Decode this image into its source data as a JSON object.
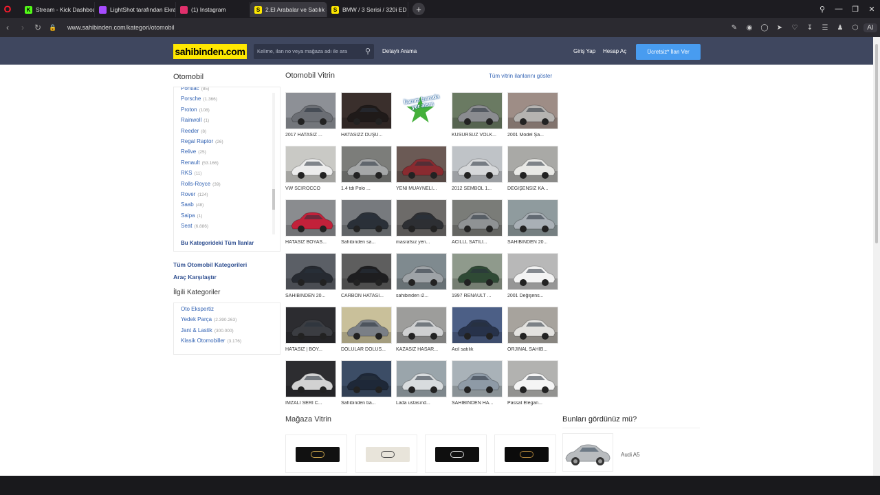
{
  "browser": {
    "tabs": [
      {
        "label": "Stream - Kick Dashboard",
        "icon": "kick-icon",
        "color": "#53fc18",
        "glyph": "K",
        "active": false
      },
      {
        "label": "LightShot tarafından Ekra",
        "icon": "lightshot-icon",
        "color": "#a64bff",
        "glyph": "",
        "active": false
      },
      {
        "label": "(1) Instagram",
        "icon": "instagram-icon",
        "color": "#e1306c",
        "glyph": "",
        "active": false
      },
      {
        "label": "2.El Arabalar ve Satılık Sıfı",
        "icon": "sahibinden-favicon",
        "color": "#ffe800",
        "glyph": "S",
        "active": true
      },
      {
        "label": "BMW / 3 Serisi / 320i ED /",
        "icon": "sahibinden-favicon",
        "color": "#ffe800",
        "glyph": "S",
        "active": false
      }
    ],
    "url_host": "www.sahibinden.com",
    "url_path": "/kategori/otomobil",
    "ai_label": "AI"
  },
  "header": {
    "logo": "sahibinden.com",
    "search_placeholder": "Kelime, ilan no veya mağaza adı ile ara",
    "advanced_search": "Detaylı Arama",
    "login": "Giriş Yap",
    "register": "Hesap Aç",
    "post_ad": "Ücretsiz* İlan Ver"
  },
  "sidebar": {
    "title": "Otomobil",
    "brands": [
      {
        "name": "Pontiac",
        "count": "(85)"
      },
      {
        "name": "Porsche",
        "count": "(1.366)"
      },
      {
        "name": "Proton",
        "count": "(108)"
      },
      {
        "name": "Rainwoll",
        "count": "(1)"
      },
      {
        "name": "Reeder",
        "count": "(8)"
      },
      {
        "name": "Regal Raptor",
        "count": "(26)"
      },
      {
        "name": "Relive",
        "count": "(25)"
      },
      {
        "name": "Renault",
        "count": "(53.166)"
      },
      {
        "name": "RKS",
        "count": "(11)"
      },
      {
        "name": "Rolls-Royce",
        "count": "(39)"
      },
      {
        "name": "Rover",
        "count": "(124)"
      },
      {
        "name": "Saab",
        "count": "(48)"
      },
      {
        "name": "Saipa",
        "count": "(1)"
      },
      {
        "name": "Seat",
        "count": "(6.886)"
      }
    ],
    "all_in_category": "Bu Kategorideki Tüm İlanlar",
    "all_categories": "Tüm Otomobil Kategorileri",
    "compare": "Araç Karşılaştır",
    "related_title": "İlgili Kategoriler",
    "related": [
      {
        "name": "Oto Ekspertiz",
        "count": ""
      },
      {
        "name": "Yedek Parça",
        "count": "(2.390.263)"
      },
      {
        "name": "Jant & Lastik",
        "count": "(300.000)"
      },
      {
        "name": "Klasik Otomobiller",
        "count": "(3.176)"
      }
    ]
  },
  "vitrin": {
    "title": "Otomobil Vitrin",
    "show_all": "Tüm vitrin ilanlarını göster",
    "ad_promo": "İlanım burada yer alsın",
    "items": [
      {
        "caption": "2017 HATASIZ ...",
        "bg": "#8d9096",
        "car": "#6b6e74"
      },
      {
        "caption": "HATASIZZ DÜŞÜ...",
        "bg": "#3a2f2c",
        "car": "#1f1a19"
      },
      {
        "caption": "",
        "bg": "#ffffff",
        "car": "",
        "promo": true
      },
      {
        "caption": "KUSURSUZ VOLK...",
        "bg": "#6a7a62",
        "car": "#8a8c90"
      },
      {
        "caption": "2001 Model Şa...",
        "bg": "#9e8d86",
        "car": "#b5b3b0"
      },
      {
        "caption": "VW SCİROCCO",
        "bg": "#c9c9c5",
        "car": "#ececec"
      },
      {
        "caption": "1.4 tdi Polo ...",
        "bg": "#7c7d7a",
        "car": "#a5a7a8"
      },
      {
        "caption": "YENİ MUAYNELİ...",
        "bg": "#6b5a55",
        "car": "#8a2b30"
      },
      {
        "caption": "2012 SEMBOL 1...",
        "bg": "#bfc3c7",
        "car": "#d6d8da"
      },
      {
        "caption": "DEĞİŞENSİZ KA...",
        "bg": "#a9a9a6",
        "car": "#e9e9e6"
      },
      {
        "caption": "HATASIZ BOYAS...",
        "bg": "#8a8c8f",
        "car": "#c2213a"
      },
      {
        "caption": "Sahibinden sa...",
        "bg": "#777a7e",
        "car": "#2a3038"
      },
      {
        "caption": "masrafsız yen...",
        "bg": "#6d6b69",
        "car": "#2d2f33"
      },
      {
        "caption": "ACİLLL SATILI...",
        "bg": "#7a7c78",
        "car": "#8f9294"
      },
      {
        "caption": "SAHİBİNDEN 20...",
        "bg": "#8f9b9e",
        "car": "#a9b0b6"
      },
      {
        "caption": "SAHİBİNDEN 20...",
        "bg": "#5b5f66",
        "car": "#262a31"
      },
      {
        "caption": "CARBON HATASI...",
        "bg": "#5e5e5e",
        "car": "#1e1e20"
      },
      {
        "caption": "sahibinden i2...",
        "bg": "#7f8a8f",
        "car": "#9ea3a7"
      },
      {
        "caption": "1997 RENAULT ...",
        "bg": "#8f9a8c",
        "car": "#2f4a35"
      },
      {
        "caption": "2001 Değişens...",
        "bg": "#b8b8b8",
        "car": "#f3f3f3"
      },
      {
        "caption": "HATASIZ | BOY...",
        "bg": "#2c2c30",
        "car": "#3b3d42"
      },
      {
        "caption": "DOLULAR DOLUS...",
        "bg": "#c9c09a",
        "car": "#7a7f86"
      },
      {
        "caption": "KAZASIZ HASAR...",
        "bg": "#9d9d9b",
        "car": "#cfd0d1"
      },
      {
        "caption": "Acil satılık",
        "bg": "#4c5f86",
        "car": "#27324a"
      },
      {
        "caption": "ORJİNAL SAHİB...",
        "bg": "#a7a39d",
        "car": "#e3e2df"
      },
      {
        "caption": "İMZALI SERİ C...",
        "bg": "#2d2d30",
        "car": "#d2d2d2"
      },
      {
        "caption": "Sahibinden ba...",
        "bg": "#3c4d66",
        "car": "#1e2838"
      },
      {
        "caption": "Lada ustasınd...",
        "bg": "#9aa5ab",
        "car": "#d8dcde"
      },
      {
        "caption": "SAHİBİNDEN HA...",
        "bg": "#a9b2b8",
        "car": "#8e9aa6"
      },
      {
        "caption": "Passat Elegan...",
        "bg": "#b2b2b0",
        "car": "#f5f5f5"
      }
    ]
  },
  "magaza": {
    "title": "Mağaza Vitrin",
    "stores": [
      {
        "icon": "store-logo-icon",
        "bg": "#111111",
        "fg": "#c8a24a"
      },
      {
        "icon": "store-logo-icon",
        "bg": "#e8e4da",
        "fg": "#4a4a4a"
      },
      {
        "icon": "store-logo-icon",
        "bg": "#0f0f0f",
        "fg": "#d8d8d8"
      },
      {
        "icon": "store-logo-icon",
        "bg": "#0b0b0b",
        "fg": "#b0843a"
      }
    ]
  },
  "seen": {
    "title": "Bunları gördünüz mü?",
    "item_name": "Audi A5"
  }
}
